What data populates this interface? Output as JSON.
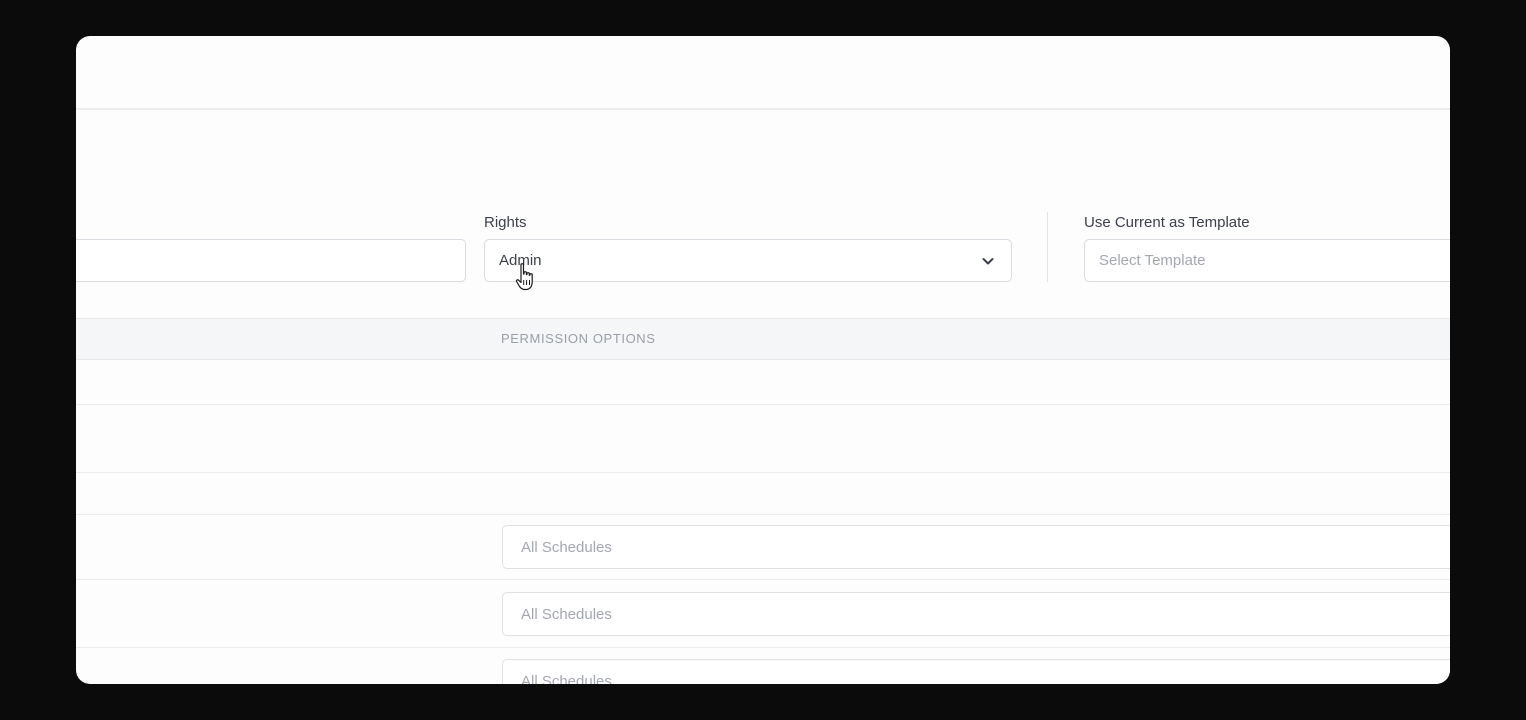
{
  "form": {
    "name_value": "",
    "rights": {
      "label": "Rights",
      "value": "Admin"
    },
    "template": {
      "label": "Use Current as Template",
      "placeholder": "Select Template"
    }
  },
  "table": {
    "header": "PERMISSION OPTIONS",
    "rows": [
      {
        "schedule": "All Schedules"
      },
      {
        "schedule": "All Schedules"
      },
      {
        "schedule": "All Schedules"
      }
    ]
  },
  "icons": {
    "dropdown": "chevron-down-icon",
    "cursor": "hand-pointer-icon"
  },
  "colors": {
    "background": "#0b0b0c",
    "panel": "#fdfdfd",
    "border": "#d9dbe0",
    "muted_text": "#a3a7b0"
  }
}
